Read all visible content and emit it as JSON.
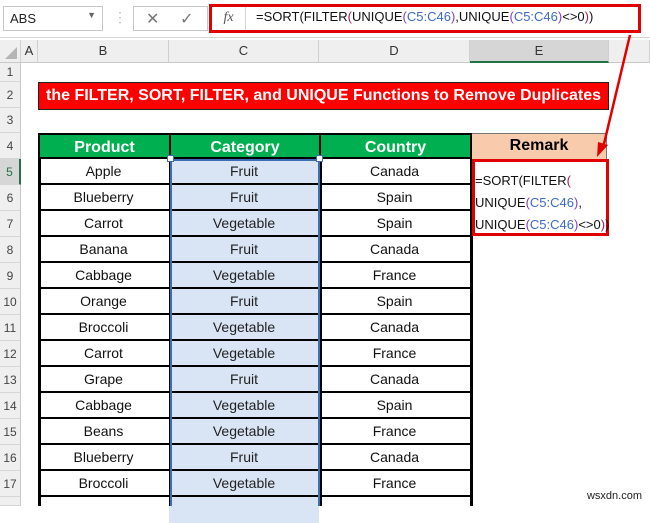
{
  "formula_bar": {
    "name_box": "ABS",
    "cancel_glyph": "✕",
    "enter_glyph": "✓",
    "fx_label": "fx",
    "formula_parts": [
      "=SORT(FILTER",
      "(",
      "UNIQUE",
      "(",
      "C5:C46",
      ")",
      ",UNIQUE",
      "(",
      "C5:C46",
      ")",
      "<>0",
      ")",
      ")"
    ]
  },
  "columns": [
    "A",
    "B",
    "C",
    "D",
    "E"
  ],
  "rows": [
    "1",
    "2",
    "3",
    "4",
    "5",
    "6",
    "7",
    "8",
    "9",
    "10",
    "11",
    "12",
    "13",
    "14",
    "15",
    "16",
    "17",
    ""
  ],
  "sheet": {
    "title": "the FILTER, SORT, FILTER, and UNIQUE Functions to Remove Duplicates",
    "headers": {
      "product": "Product",
      "category": "Category",
      "country": "Country",
      "remark": "Remark"
    },
    "data": [
      [
        "Apple",
        "Fruit",
        "Canada"
      ],
      [
        "Blueberry",
        "Fruit",
        "Spain"
      ],
      [
        "Carrot",
        "Vegetable",
        "Spain"
      ],
      [
        "Banana",
        "Fruit",
        "Canada"
      ],
      [
        "Cabbage",
        "Vegetable",
        "France"
      ],
      [
        "Orange",
        "Fruit",
        "Spain"
      ],
      [
        "Broccoli",
        "Vegetable",
        "Canada"
      ],
      [
        "Carrot",
        "Vegetable",
        "France"
      ],
      [
        "Grape",
        "Fruit",
        "Canada"
      ],
      [
        "Cabbage",
        "Vegetable",
        "Spain"
      ],
      [
        "Beans",
        "Vegetable",
        "France"
      ],
      [
        "Blueberry",
        "Fruit",
        "Canada"
      ],
      [
        "Broccoli",
        "Vegetable",
        "France"
      ]
    ],
    "remark_lines": [
      [
        {
          "t": "=SORT(FILTER",
          "c": ""
        },
        {
          "t": "(",
          "c": "p1"
        }
      ],
      [
        {
          "t": "UNIQUE",
          "c": ""
        },
        {
          "t": "(",
          "c": "p2"
        },
        {
          "t": "C5:C46",
          "c": "r1"
        },
        {
          "t": ")",
          "c": "p2"
        },
        {
          "t": ",",
          "c": ""
        }
      ],
      [
        {
          "t": "UNIQUE",
          "c": ""
        },
        {
          "t": "(",
          "c": "p2"
        },
        {
          "t": "C5:C46",
          "c": "r1"
        },
        {
          "t": ")",
          "c": "p2"
        },
        {
          "t": "<>0",
          "c": ""
        },
        {
          "t": ")",
          "c": "p1"
        },
        {
          "t": ")",
          "c": ""
        }
      ]
    ]
  },
  "colors": {
    "header_green": "#00b050",
    "title_red": "#ff0000",
    "remark_peach": "#f8cbad",
    "selection_blue": "#3c6eb4",
    "callout_red": "#e00000"
  },
  "watermark": "wsxdn.com"
}
